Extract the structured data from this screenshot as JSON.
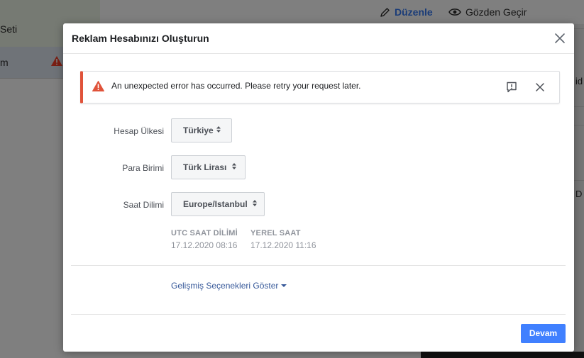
{
  "background": {
    "sidebar_text_1": "Seti",
    "sidebar_text_2": "m",
    "edit_label": "Düzenle",
    "preview_label": "Gözden Geçir",
    "right_char_1": "id",
    "right_char_2": "D"
  },
  "modal": {
    "title": "Reklam Hesabınızı Oluşturun",
    "error": {
      "message": "An unexpected error has occurred. Please retry your request later.",
      "accent_color": "#e0533a"
    },
    "fields": [
      {
        "label": "Hesap Ülkesi",
        "value": "Türkiye"
      },
      {
        "label": "Para Birimi",
        "value": "Türk Lirası"
      },
      {
        "label": "Saat Dilimi",
        "value": "Europe/Istanbul"
      }
    ],
    "timezone": {
      "utc_header": "UTC SAAT DİLİMİ",
      "utc_value": "17.12.2020 08:16",
      "local_header": "YEREL SAAT",
      "local_value": "17.12.2020 11:16"
    },
    "advanced_link": "Gelişmiş Seçenekleri Göster",
    "continue_button": "Devam",
    "primary_color": "#4080ff"
  }
}
